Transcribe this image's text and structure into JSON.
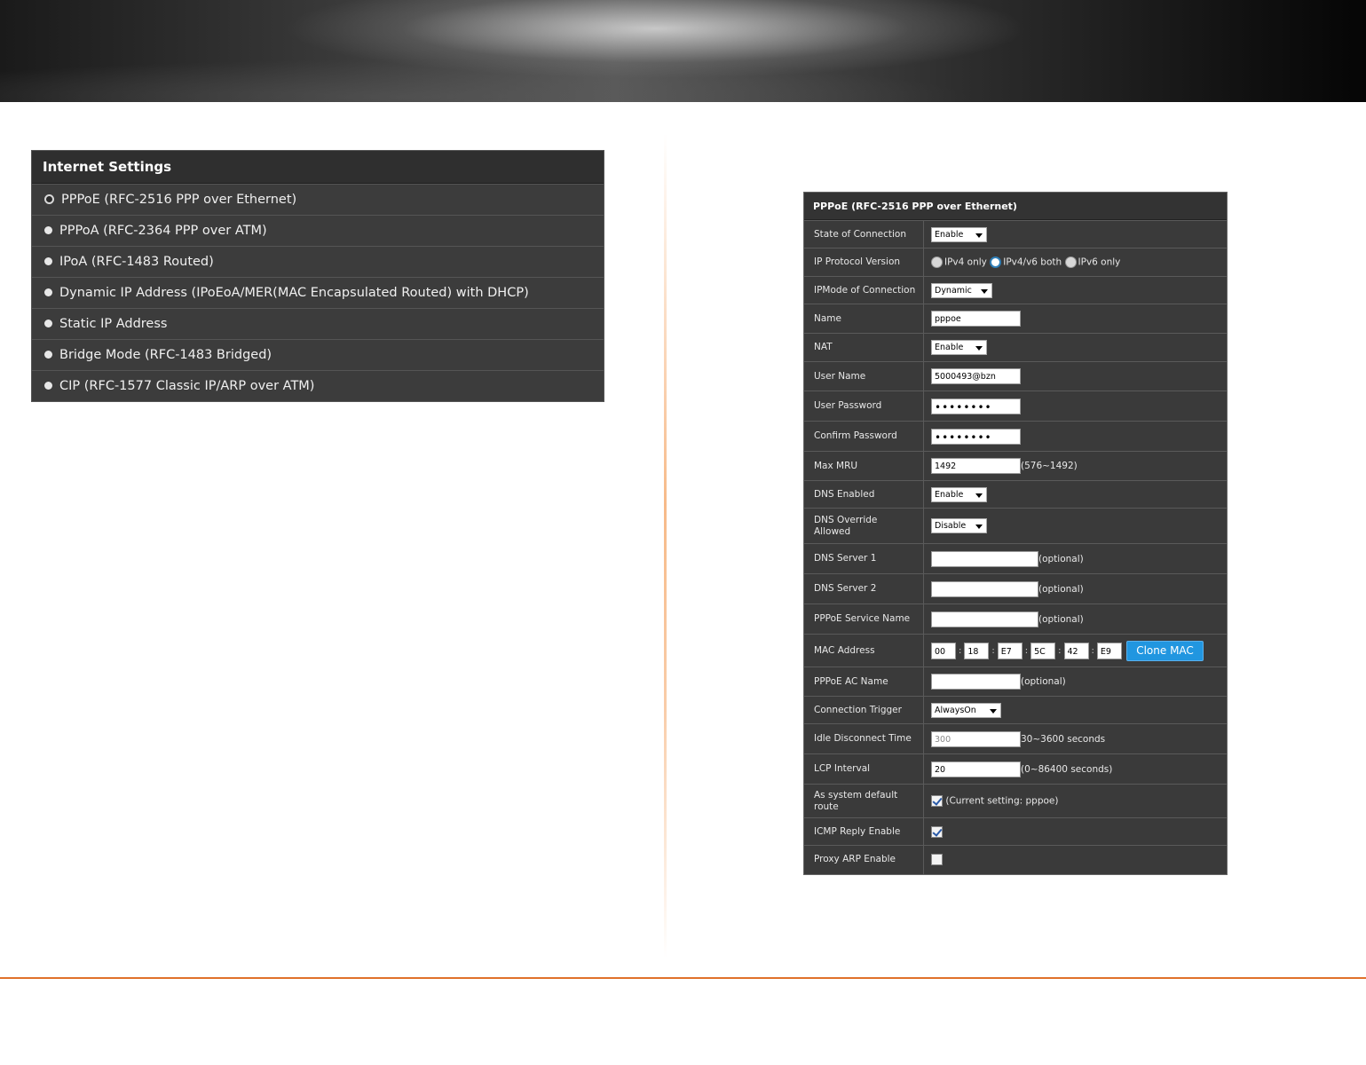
{
  "internet_settings": {
    "title": "Internet Settings",
    "options": [
      {
        "label": "PPPoE (RFC-2516 PPP over Ethernet)",
        "selected": true
      },
      {
        "label": "PPPoA (RFC-2364 PPP over ATM)",
        "selected": false
      },
      {
        "label": "IPoA (RFC-1483 Routed)",
        "selected": false
      },
      {
        "label": "Dynamic IP Address (IPoEoA/MER(MAC Encapsulated Routed) with DHCP)",
        "selected": false
      },
      {
        "label": "Static IP Address",
        "selected": false
      },
      {
        "label": "Bridge Mode (RFC-1483 Bridged)",
        "selected": false
      },
      {
        "label": "CIP (RFC-1577 Classic IP/ARP over ATM)",
        "selected": false
      }
    ]
  },
  "pppoe": {
    "title": "PPPoE (RFC-2516 PPP over Ethernet)",
    "state_of_connection": {
      "label": "State of Connection",
      "value": "Enable"
    },
    "ip_protocol_version": {
      "label": "IP Protocol Version",
      "options": [
        "IPv4 only",
        "IPv4/v6 both",
        "IPv6 only"
      ],
      "selected": "IPv4/v6 both"
    },
    "ipmode": {
      "label": "IPMode of Connection",
      "value": "Dynamic"
    },
    "name": {
      "label": "Name",
      "value": "pppoe"
    },
    "nat": {
      "label": "NAT",
      "value": "Enable"
    },
    "user_name": {
      "label": "User Name",
      "value": "5000493@bzn"
    },
    "user_password": {
      "label": "User Password",
      "value": "••••••••"
    },
    "confirm_password": {
      "label": "Confirm Password",
      "value": "••••••••"
    },
    "max_mru": {
      "label": "Max MRU",
      "value": "1492",
      "hint": "(576~1492)"
    },
    "dns_enabled": {
      "label": "DNS Enabled",
      "value": "Enable"
    },
    "dns_override": {
      "label_line1": "DNS Override",
      "label_line2": "Allowed",
      "value": "Disable"
    },
    "dns_server1": {
      "label": "DNS Server 1",
      "value": "",
      "hint": "(optional)"
    },
    "dns_server2": {
      "label": "DNS Server 2",
      "value": "",
      "hint": "(optional)"
    },
    "pppoe_service_name": {
      "label": "PPPoE Service Name",
      "value": "",
      "hint": "(optional)"
    },
    "mac_address": {
      "label": "MAC Address",
      "octets": [
        "00",
        "18",
        "E7",
        "5C",
        "42",
        "E9"
      ],
      "clone_label": "Clone MAC"
    },
    "pppoe_ac_name": {
      "label": "PPPoE AC Name",
      "value": "",
      "hint": "(optional)"
    },
    "connection_trigger": {
      "label": "Connection Trigger",
      "value": "AlwaysOn"
    },
    "idle_disconnect": {
      "label": "Idle Disconnect Time",
      "value": "300",
      "hint": "30~3600 seconds"
    },
    "lcp_interval": {
      "label": "LCP Interval",
      "value": "20",
      "hint": "(0~86400 seconds)"
    },
    "default_route": {
      "label_line1": "As system default",
      "label_line2": "route",
      "checked": true,
      "hint": "(Current setting: pppoe)"
    },
    "icmp_reply": {
      "label": "ICMP Reply Enable",
      "checked": true
    },
    "proxy_arp": {
      "label": "Proxy ARP Enable",
      "checked": false
    }
  }
}
